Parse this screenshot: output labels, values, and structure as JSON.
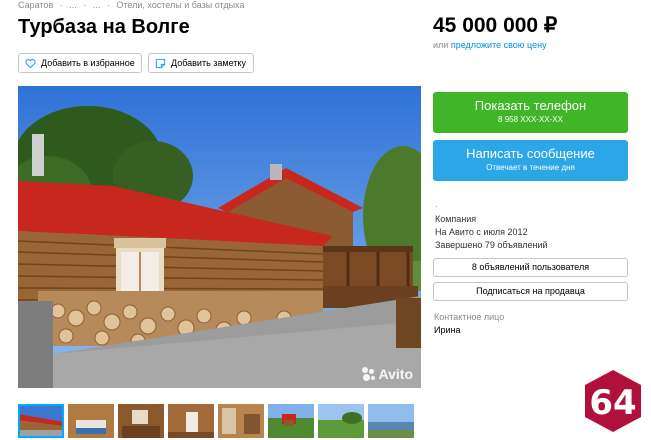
{
  "breadcrumb": [
    "Саратов",
    "·",
    "...",
    "·",
    "...",
    "·",
    "Отели, хостелы и базы отдыха"
  ],
  "title": "Турбаза на Волге",
  "actions": {
    "favorite_label": "Добавить в избранное",
    "note_label": "Добавить заметку"
  },
  "price": {
    "value": "45 000 000 ₽",
    "alt_prefix": "или",
    "alt_link": "предложите свою цену"
  },
  "phone_button": {
    "label": "Показать телефон",
    "number": "8 958 XXX-XX-XX"
  },
  "message_button": {
    "label": "Написать сообщение",
    "sub": "Отвечает в течение дня"
  },
  "seller": {
    "dot": "·",
    "type": "Компания",
    "since": "На Авито с июля 2012",
    "completed": "Завершено 79 объявлений"
  },
  "seller_ads_button": "8 объявлений пользователя",
  "subscribe_button": "Подписаться на продавца",
  "contact": {
    "label": "Контактное лицо",
    "name": "Ирина"
  },
  "watermark": "Avito",
  "logo_text": "64",
  "colors": {
    "phone_green": "#3fb527",
    "message_blue": "#2ba6e6",
    "link_blue": "#0091d9",
    "logo_red": "#b0113a"
  },
  "thumbnails": [
    "thumb-1",
    "thumb-2",
    "thumb-3",
    "thumb-4",
    "thumb-5",
    "thumb-6",
    "thumb-7",
    "thumb-8"
  ]
}
